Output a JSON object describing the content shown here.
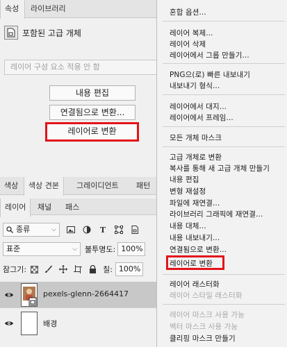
{
  "properties": {
    "tabs": [
      "속성",
      "라이브러리"
    ],
    "object_label": "포함된 고급 개체",
    "comp_placeholder": "레이어 구성 요소 적용 안 함",
    "btn_edit": "내용 편집",
    "btn_convert_linked": "연결됨으로 변환...",
    "btn_convert_layer": "레이어로 변환"
  },
  "color_tabs": [
    "색상",
    "색상 견본",
    "그레이디언트",
    "패턴"
  ],
  "layers_panel": {
    "tabs": [
      "레이어",
      "채널",
      "패스"
    ],
    "filter_kind": "종류",
    "blend_mode": "표준",
    "opacity_label": "불투명도:",
    "opacity_value": "100%",
    "lock_label": "잠그기:",
    "fill_label": "칠:",
    "fill_value": "100%",
    "layers": [
      {
        "name": "pexels-glenn-2664417",
        "selected": true
      },
      {
        "name": "배경",
        "selected": false
      }
    ]
  },
  "context_menu": {
    "items": [
      {
        "label": "혼합 옵션...",
        "disabled": false
      },
      {
        "label": "레이어 복제...",
        "disabled": false
      },
      {
        "label": "레이어 삭제",
        "disabled": false
      },
      {
        "label": "레이어에서 그룹 만들기...",
        "disabled": false
      },
      {
        "label": "PNG으(로) 빠른 내보내기",
        "disabled": false
      },
      {
        "label": "내보내기 형식...",
        "disabled": false
      },
      {
        "label": "레이어에서 대지...",
        "disabled": false
      },
      {
        "label": "레이어에서 프레임...",
        "disabled": false
      },
      {
        "label": "모든 개체 마스크",
        "disabled": false
      },
      {
        "label": "고급 개체로 변환",
        "disabled": false
      },
      {
        "label": "복사를 통해 새 고급 개체 만들기",
        "disabled": false
      },
      {
        "label": "내용 편집",
        "disabled": false
      },
      {
        "label": "변형 재설정",
        "disabled": false
      },
      {
        "label": "파일에 재연결...",
        "disabled": false
      },
      {
        "label": "라이브러리 그래픽에 재연결...",
        "disabled": false
      },
      {
        "label": "내용 대체...",
        "disabled": false
      },
      {
        "label": "내용 내보내기...",
        "disabled": false
      },
      {
        "label": "연결됨으로 변환...",
        "disabled": false
      },
      {
        "label": "레이어로 변환",
        "disabled": false
      },
      {
        "label": "레이어 래스터화",
        "disabled": false
      },
      {
        "label": "레이어 스타일 래스터화",
        "disabled": true
      },
      {
        "label": "레이어 마스크 사용 가능",
        "disabled": true
      },
      {
        "label": "벡터 마스크 사용 가능",
        "disabled": true
      },
      {
        "label": "클리핑 마스크 만들기",
        "disabled": false
      }
    ]
  },
  "colors": {
    "highlight": "#e3131a",
    "disabled_text": "#a8a8a8",
    "selected_layer": "#c8c8c8"
  }
}
